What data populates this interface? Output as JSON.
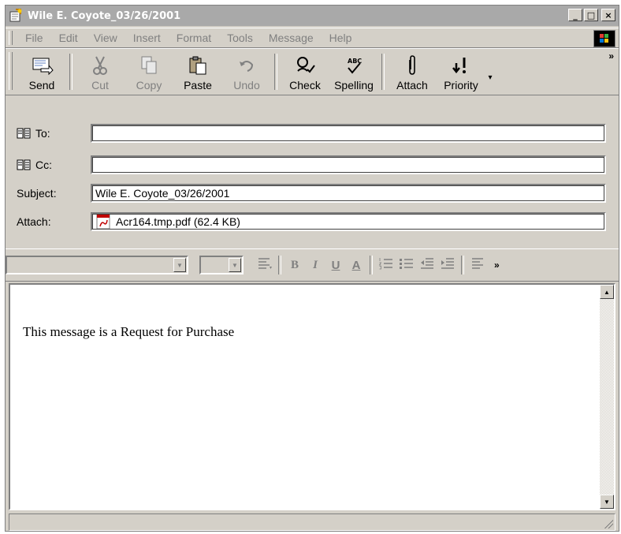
{
  "window": {
    "title": "Wile E. Coyote_03/26/2001",
    "minimize": "_",
    "maximize": "□",
    "close": "×"
  },
  "menu": {
    "items": [
      "File",
      "Edit",
      "View",
      "Insert",
      "Format",
      "Tools",
      "Message",
      "Help"
    ]
  },
  "toolbar": {
    "buttons": [
      {
        "label": "Send",
        "icon": "send-icon",
        "enabled": true
      },
      {
        "label": "Cut",
        "icon": "cut-icon",
        "enabled": false
      },
      {
        "label": "Copy",
        "icon": "copy-icon",
        "enabled": false
      },
      {
        "label": "Paste",
        "icon": "paste-icon",
        "enabled": true
      },
      {
        "label": "Undo",
        "icon": "undo-icon",
        "enabled": false
      },
      {
        "label": "Check",
        "icon": "check-names-icon",
        "enabled": true
      },
      {
        "label": "Spelling",
        "icon": "spelling-icon",
        "enabled": true
      },
      {
        "label": "Attach",
        "icon": "paperclip-icon",
        "enabled": true
      },
      {
        "label": "Priority",
        "icon": "priority-icon",
        "enabled": true
      }
    ],
    "more": "»"
  },
  "header": {
    "to_label": "To:",
    "to_value": "",
    "cc_label": "Cc:",
    "cc_value": "",
    "subject_label": "Subject:",
    "subject_value": "Wile E. Coyote_03/26/2001",
    "attach_label": "Attach:",
    "attach_value": "Acr164.tmp.pdf (62.4 KB)"
  },
  "format_toolbar": {
    "bold": "B",
    "italic": "I",
    "underline": "U",
    "font_color": "A",
    "more": "»"
  },
  "body": {
    "text": "This message is a Request for Purchase"
  }
}
